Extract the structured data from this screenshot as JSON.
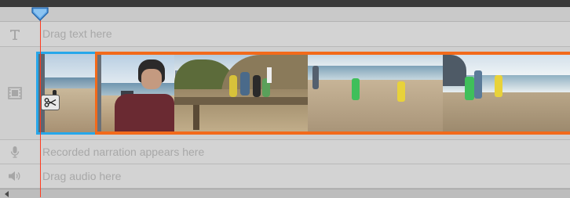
{
  "tracks": {
    "text": {
      "icon": "text-T-icon",
      "hint": "Drag text here"
    },
    "video": {
      "icon": "film-icon"
    },
    "narration": {
      "icon": "microphone-icon",
      "hint": "Recorded narration appears here"
    },
    "audio": {
      "icon": "speaker-icon",
      "hint": "Drag audio here"
    }
  },
  "colors": {
    "selected_clip_border": "#27a7ea",
    "clip_border": "#f26a1b",
    "playhead": "#ff3b1f"
  }
}
